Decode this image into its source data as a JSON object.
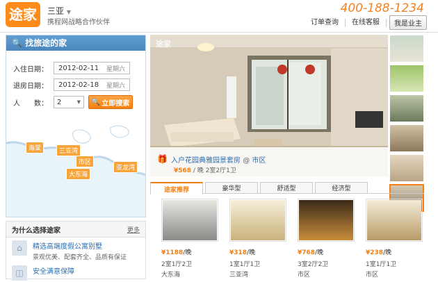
{
  "header": {
    "logo_text": "途家",
    "city": "三亚",
    "tagline": "携程网战略合作伙伴",
    "phone": "400-188-1234",
    "links": [
      "订单查询",
      "在线客服"
    ],
    "owner_button": "我是业主"
  },
  "search": {
    "title": "找旅途的家",
    "checkin_label": "入住日期：",
    "checkin_date": "2012-02-11",
    "checkin_week": "星期六",
    "checkout_label": "退房日期：",
    "checkout_date": "2012-02-18",
    "checkout_week": "星期六",
    "guests_label": "人　　数：",
    "guests_value": "2",
    "search_button": "立即搜索"
  },
  "map": {
    "labels": [
      "海棠",
      "三亚湾",
      "市区",
      "大东海",
      "亚龙湾"
    ]
  },
  "why": {
    "title": "为什么选择途家",
    "more": "更多",
    "items": [
      {
        "title": "精选高端度假公寓别墅",
        "desc": "景观优美、配套齐全、品质有保证"
      },
      {
        "title": "安全满意保障"
      }
    ]
  },
  "gallery": {
    "watermark": "途家",
    "title": "入户花园典雅园景套房",
    "at": "@",
    "area": "市区",
    "price": "¥568",
    "price_suffix": " / 晚  2室2厅1卫"
  },
  "tabs": [
    "途家推荐",
    "豪华型",
    "舒适型",
    "经济型"
  ],
  "listings": [
    {
      "price": "¥1188",
      "unit": "/晚",
      "rooms": "2室1厅2卫",
      "loc": "大东海"
    },
    {
      "price": "¥318",
      "unit": "/晚",
      "rooms": "1室1厅1卫",
      "loc": "三亚湾"
    },
    {
      "price": "¥768",
      "unit": "/晚",
      "rooms": "3室2厅2卫",
      "loc": "市区"
    },
    {
      "price": "¥238",
      "unit": "/晚",
      "rooms": "1室1厅1卫",
      "loc": "市区"
    }
  ],
  "colors": {
    "accent": "#f57f10",
    "blue": "#4a86bd",
    "link": "#2a6fb5"
  }
}
